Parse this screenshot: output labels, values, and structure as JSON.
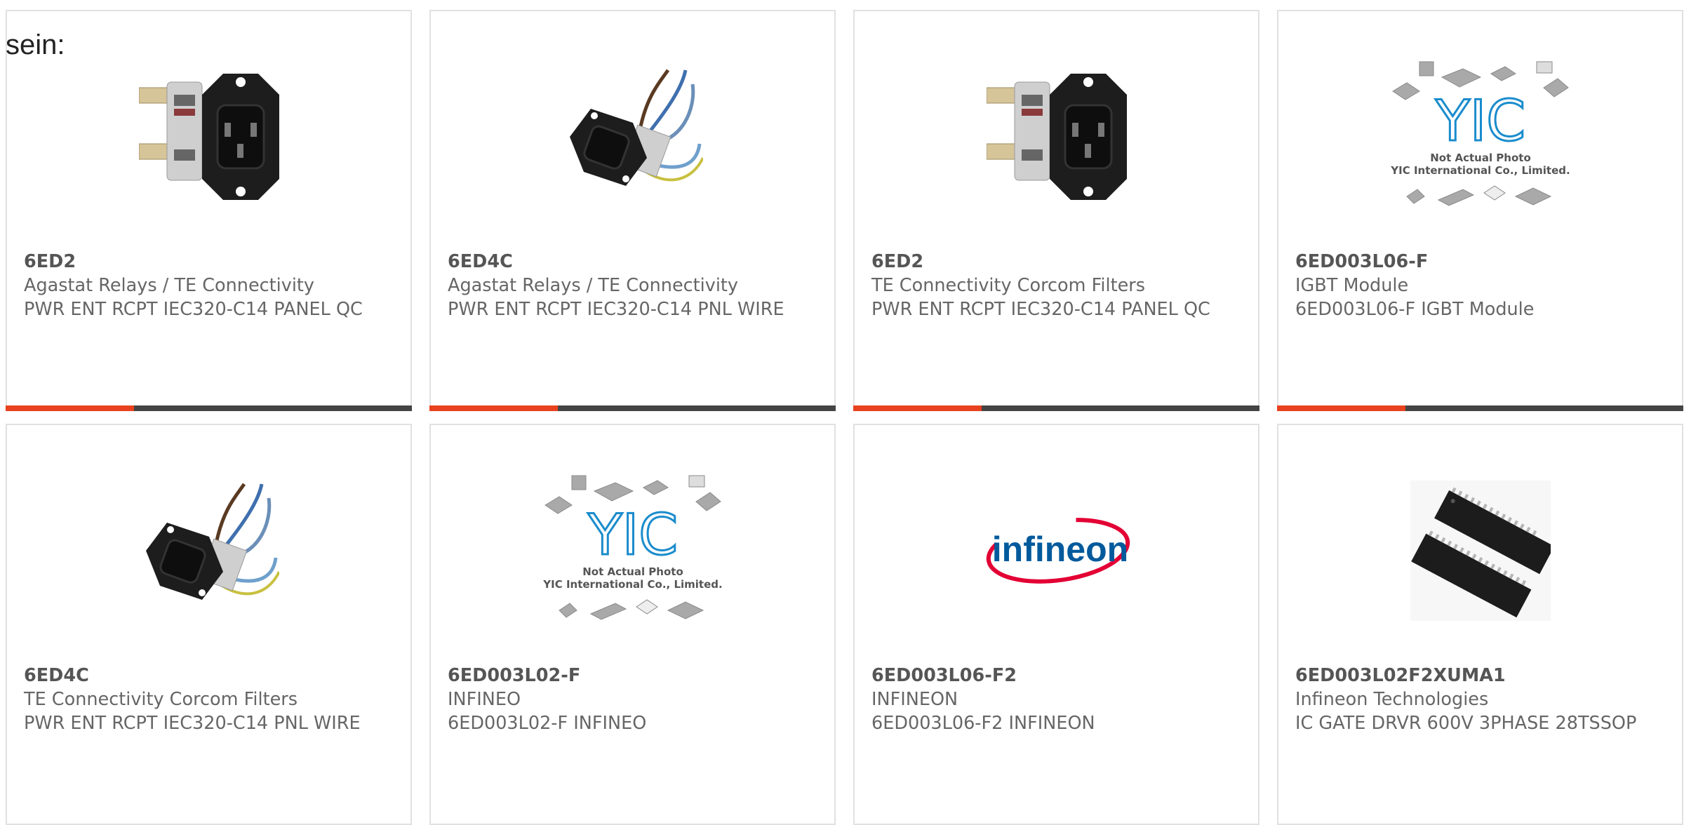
{
  "page": {
    "heading": "sein:"
  },
  "products": [
    {
      "part": "6ED2",
      "brand": "Agastat Relays / TE Connectivity",
      "desc": "PWR ENT RCPT IEC320-C14 PANEL QC",
      "image": "iec-inlet-qc-terminals"
    },
    {
      "part": "6ED4C",
      "brand": "Agastat Relays / TE Connectivity",
      "desc": "PWR ENT RCPT IEC320-C14 PNL WIRE",
      "image": "iec-inlet-wire-leads"
    },
    {
      "part": "6ED2",
      "brand": "TE Connectivity Corcom Filters",
      "desc": "PWR ENT RCPT IEC320-C14 PANEL QC",
      "image": "iec-inlet-qc-terminals"
    },
    {
      "part": "6ED003L06-F",
      "brand": "IGBT Module",
      "desc": "6ED003L06-F IGBT Module",
      "image": "yic-placeholder"
    },
    {
      "part": "6ED4C",
      "brand": "TE Connectivity Corcom Filters",
      "desc": "PWR ENT RCPT IEC320-C14 PNL WIRE",
      "image": "iec-inlet-wire-leads"
    },
    {
      "part": "6ED003L02-F",
      "brand": "INFINEO",
      "desc": "6ED003L02-F INFINEO",
      "image": "yic-placeholder"
    },
    {
      "part": "6ED003L06-F2",
      "brand": "INFINEON",
      "desc": "6ED003L06-F2 INFINEON",
      "image": "infineon-logo"
    },
    {
      "part": "6ED003L02F2XUMA1",
      "brand": "Infineon Technologies",
      "desc": "IC GATE DRVR 600V 3PHASE 28TSSOP",
      "image": "tssop-chip"
    }
  ],
  "placeholder": {
    "logo_text": "YIC",
    "line1": "Not Actual Photo",
    "line2": "YIC International Co., Limited."
  },
  "infineon_logo_text": "infineon",
  "colors": {
    "accent": "#e8411d",
    "bar": "#444444",
    "border": "#e1e1e1",
    "text": "#666666",
    "yic_blue": "#1a8ccc",
    "infineon_red": "#e30034",
    "infineon_blue": "#005a9c"
  }
}
